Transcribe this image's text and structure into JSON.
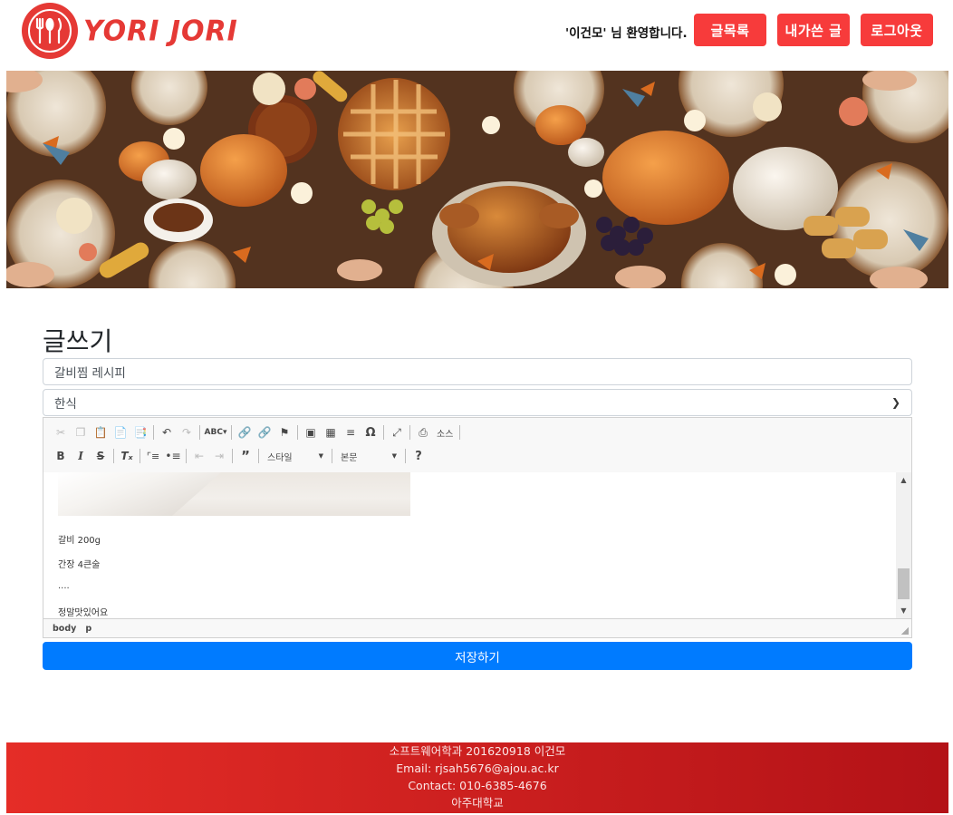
{
  "brand": {
    "name": "YORI JORI",
    "color": "#e53935"
  },
  "header": {
    "welcome": "'이건모' 님 환영합니다.",
    "buttons": {
      "list": "글목록",
      "mine": "내가쓴 글",
      "logout": "로그아웃"
    },
    "button_color": "#f73b3b"
  },
  "banner": {
    "alt": "holiday feast table banner"
  },
  "form": {
    "heading": "글쓰기",
    "title_value": "갈비찜 레시피",
    "category_value": "한식",
    "save_label": "저장하기"
  },
  "editor": {
    "toolbar_row1": [
      "cut-icon",
      "copy-icon",
      "paste-icon",
      "paste-text-icon",
      "paste-word-icon",
      "undo-icon",
      "redo-icon",
      "spellcheck-icon",
      "link-icon",
      "unlink-icon",
      "anchor-icon",
      "image-icon",
      "table-icon",
      "horizontal-rule-icon",
      "special-char-icon",
      "maximize-icon",
      "source-icon"
    ],
    "source_label": "소스",
    "style_label": "스타일",
    "format_label": "본문",
    "content_lines": [
      "갈비 200g",
      "간장 4큰술",
      "....",
      "정말맛있어요"
    ],
    "path": [
      "body",
      "p"
    ]
  },
  "footer": {
    "line1": "소프트웨어학과 201620918 이건모",
    "line2": "Email: rjsah5676@ajou.ac.kr",
    "line3": "Contact: 010-6385-4676",
    "line4": "아주대학교"
  }
}
